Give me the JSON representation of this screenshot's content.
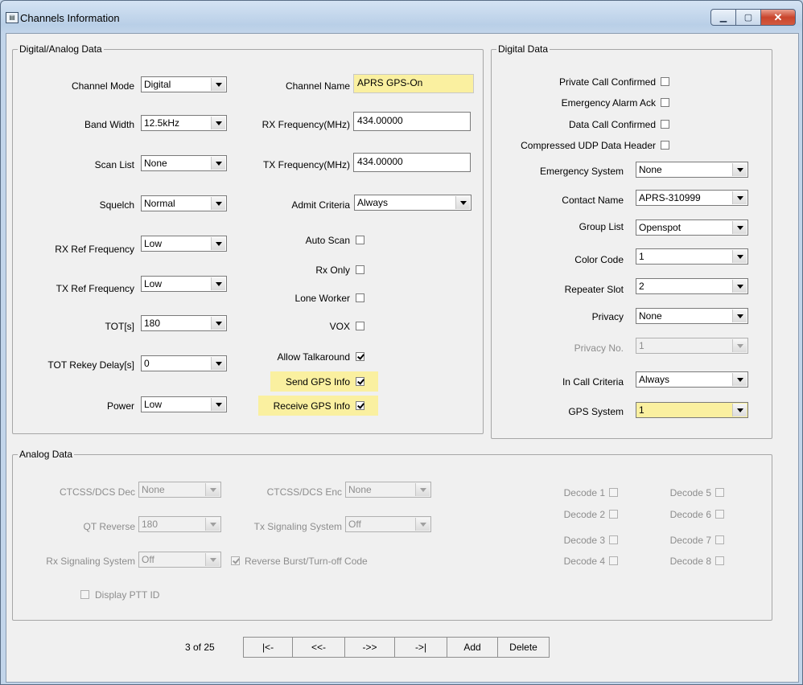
{
  "window": {
    "title": "Channels Information",
    "icon": "app-icon"
  },
  "groups": {
    "digital_analog": "Digital/Analog Data",
    "digital": "Digital Data",
    "analog": "Analog Data"
  },
  "da": {
    "channel_mode": {
      "label": "Channel Mode",
      "value": "Digital"
    },
    "band_width": {
      "label": "Band Width",
      "value": "12.5kHz"
    },
    "scan_list": {
      "label": "Scan List",
      "value": "None"
    },
    "squelch": {
      "label": "Squelch",
      "value": "Normal"
    },
    "rx_ref": {
      "label": "RX Ref Frequency",
      "value": "Low"
    },
    "tx_ref": {
      "label": "TX Ref Frequency",
      "value": "Low"
    },
    "tot": {
      "label": "TOT[s]",
      "value": "180"
    },
    "tot_rekey": {
      "label": "TOT Rekey Delay[s]",
      "value": "0"
    },
    "power": {
      "label": "Power",
      "value": "Low"
    },
    "channel_name": {
      "label": "Channel Name",
      "value": "APRS GPS-On"
    },
    "rx_freq": {
      "label": "RX Frequency(MHz)",
      "value": "434.00000"
    },
    "tx_freq": {
      "label": "TX Frequency(MHz)",
      "value": "434.00000"
    },
    "admit": {
      "label": "Admit Criteria",
      "value": "Always"
    },
    "auto_scan": {
      "label": "Auto Scan",
      "checked": false
    },
    "rx_only": {
      "label": "Rx Only",
      "checked": false
    },
    "lone_worker": {
      "label": "Lone Worker",
      "checked": false
    },
    "vox": {
      "label": "VOX",
      "checked": false
    },
    "allow_talkaround": {
      "label": "Allow Talkaround",
      "checked": true
    },
    "send_gps": {
      "label": "Send GPS Info",
      "checked": true
    },
    "receive_gps": {
      "label": "Receive GPS Info",
      "checked": true
    }
  },
  "digital": {
    "private_call": {
      "label": "Private Call Confirmed",
      "checked": false
    },
    "emergency_ack": {
      "label": "Emergency Alarm Ack",
      "checked": false
    },
    "data_call": {
      "label": "Data Call Confirmed",
      "checked": false
    },
    "compressed_udp": {
      "label": "Compressed UDP Data Header",
      "checked": false
    },
    "emergency_system": {
      "label": "Emergency System",
      "value": "None"
    },
    "contact_name": {
      "label": "Contact Name",
      "value": "APRS-310999"
    },
    "group_list": {
      "label": "Group List",
      "value": "Openspot"
    },
    "color_code": {
      "label": "Color Code",
      "value": "1"
    },
    "repeater_slot": {
      "label": "Repeater Slot",
      "value": "2"
    },
    "privacy": {
      "label": "Privacy",
      "value": "None"
    },
    "privacy_no": {
      "label": "Privacy No.",
      "value": "1"
    },
    "in_call": {
      "label": "In Call Criteria",
      "value": "Always"
    },
    "gps_system": {
      "label": "GPS System",
      "value": "1"
    }
  },
  "analog": {
    "ctcss_dec": {
      "label": "CTCSS/DCS Dec",
      "value": "None"
    },
    "ctcss_enc": {
      "label": "CTCSS/DCS Enc",
      "value": "None"
    },
    "qt_reverse": {
      "label": "QT Reverse",
      "value": "180"
    },
    "tx_sig": {
      "label": "Tx Signaling System",
      "value": "Off"
    },
    "rx_sig": {
      "label": "Rx Signaling System",
      "value": "Off"
    },
    "reverse_burst": {
      "label": "Reverse Burst/Turn-off Code",
      "checked": true
    },
    "display_ptt": {
      "label": "Display PTT ID",
      "checked": false
    },
    "decodes": [
      "Decode 1",
      "Decode 2",
      "Decode 3",
      "Decode 4",
      "Decode 5",
      "Decode 6",
      "Decode 7",
      "Decode 8"
    ]
  },
  "nav": {
    "position": "3 of 25",
    "first": "|<-",
    "prev": "<<-",
    "next": "->>",
    "last": "->|",
    "add": "Add",
    "delete": "Delete"
  },
  "colors": {
    "highlight": "#faf0a0",
    "close_button": "#c9452c"
  }
}
